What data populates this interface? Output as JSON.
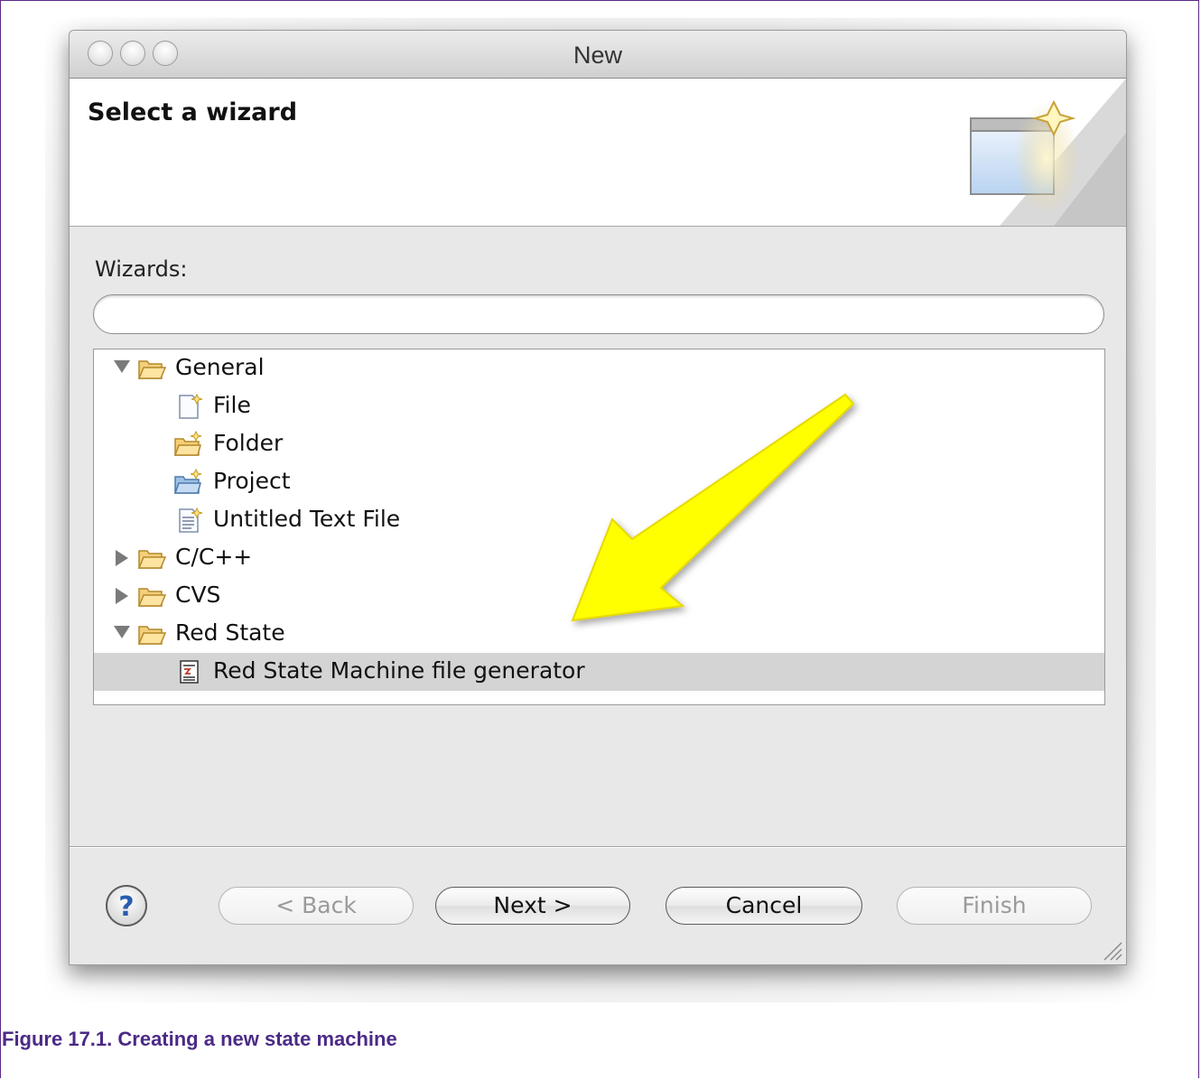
{
  "window": {
    "title": "New"
  },
  "header": {
    "heading": "Select a wizard"
  },
  "wizards_label": "Wizards:",
  "filter": {
    "value": "",
    "placeholder": ""
  },
  "tree": {
    "items": [
      {
        "label": "General",
        "expanded": true,
        "depth": 0,
        "icon": "folder-open-icon"
      },
      {
        "label": "File",
        "depth": 1,
        "icon": "new-file-icon"
      },
      {
        "label": "Folder",
        "depth": 1,
        "icon": "new-folder-icon"
      },
      {
        "label": "Project",
        "depth": 1,
        "icon": "new-project-icon"
      },
      {
        "label": "Untitled Text File",
        "depth": 1,
        "icon": "new-text-file-icon"
      },
      {
        "label": "C/C++",
        "expanded": false,
        "depth": 0,
        "icon": "folder-open-icon"
      },
      {
        "label": "CVS",
        "expanded": false,
        "depth": 0,
        "icon": "folder-open-icon"
      },
      {
        "label": "Red State",
        "expanded": true,
        "depth": 0,
        "icon": "folder-open-icon"
      },
      {
        "label": "Red State Machine file generator",
        "depth": 1,
        "icon": "state-machine-icon",
        "selected": true
      }
    ]
  },
  "buttons": {
    "help": "?",
    "back": "< Back",
    "next": "Next >",
    "cancel": "Cancel",
    "finish": "Finish"
  },
  "caption": "Figure 17.1. Creating a new state machine",
  "colors": {
    "caption": "#4b2a86",
    "frame_border": "#5b2a86",
    "selection": "#d4d4d4",
    "arrow": "#ffff00"
  }
}
